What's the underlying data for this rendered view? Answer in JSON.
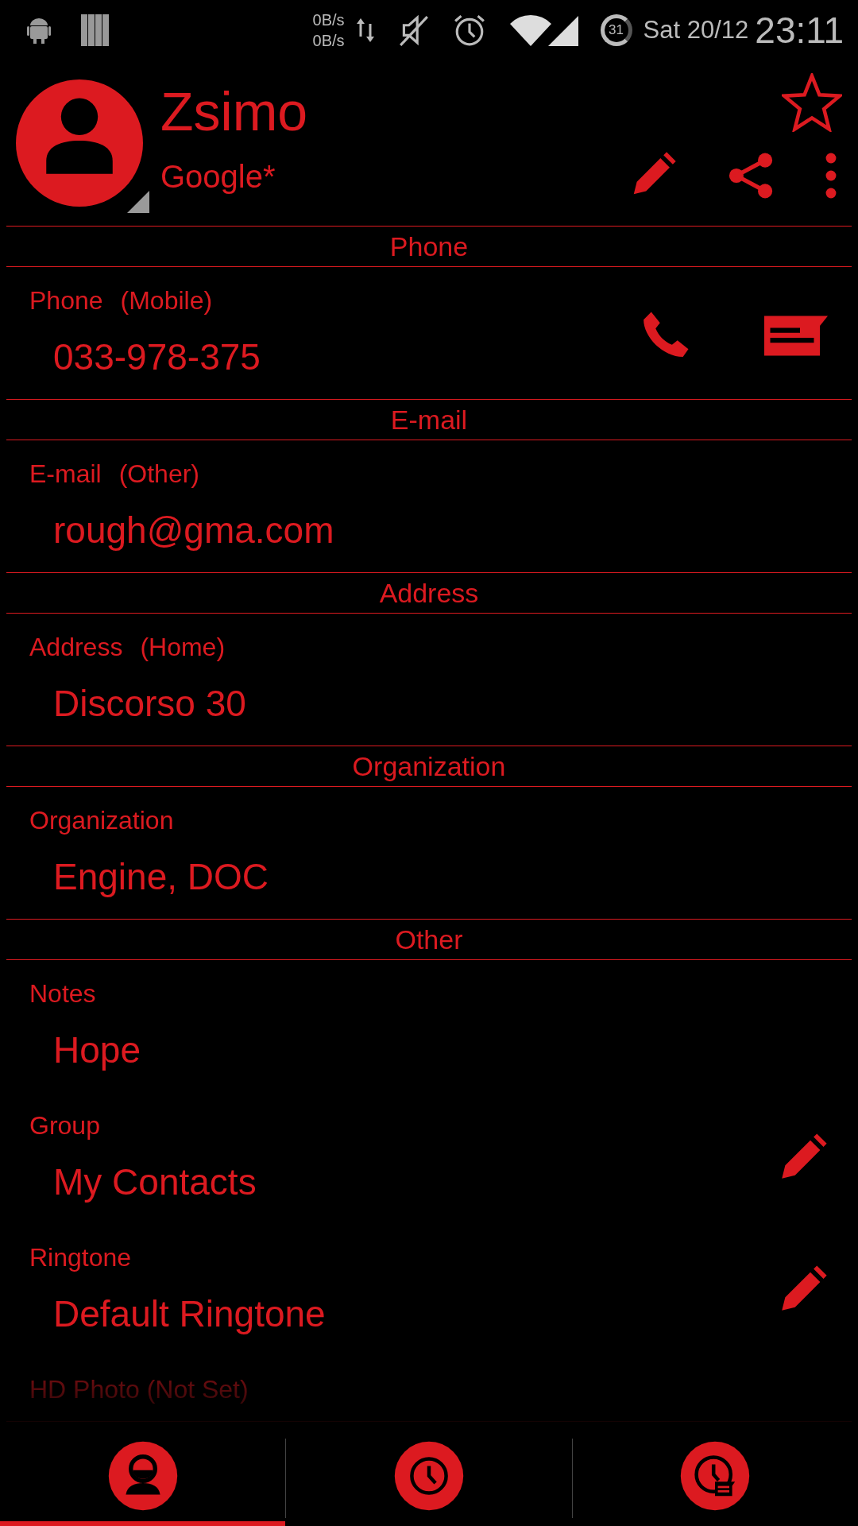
{
  "status_bar": {
    "net_up": "0B/s",
    "net_down": "0B/s",
    "battery": "31",
    "date": "Sat 20/12",
    "time": "23:11"
  },
  "contact": {
    "name": "Zsimo",
    "account": "Google*",
    "starred": false
  },
  "sections": [
    {
      "title": "Phone",
      "rows": [
        {
          "label": "Phone",
          "type": "(Mobile)",
          "value": "033-978-375",
          "actions": [
            {
              "kind": "call"
            },
            {
              "kind": "message"
            }
          ]
        }
      ]
    },
    {
      "title": "E-mail",
      "rows": [
        {
          "label": "E-mail",
          "type": "(Other)",
          "value": "rough@gma.com",
          "actions": []
        }
      ]
    },
    {
      "title": "Address",
      "rows": [
        {
          "label": "Address",
          "type": "(Home)",
          "value": "Discorso 30",
          "actions": []
        }
      ]
    },
    {
      "title": "Organization",
      "rows": [
        {
          "label": "Organization",
          "value": "Engine, DOC",
          "actions": []
        }
      ]
    },
    {
      "title": "Other",
      "rows": [
        {
          "label": "Notes",
          "value": "Hope",
          "actions": []
        },
        {
          "label": "Group",
          "value": "My Contacts",
          "actions": [
            {
              "kind": "edit"
            }
          ]
        },
        {
          "label": "Ringtone",
          "value": "Default Ringtone",
          "actions": [
            {
              "kind": "edit"
            }
          ]
        },
        {
          "label": "HD Photo (Not Set)",
          "actions": []
        }
      ]
    }
  ],
  "tabs": [
    {
      "kind": "contact",
      "selected": true
    },
    {
      "kind": "history",
      "selected": false
    },
    {
      "kind": "scheduled",
      "selected": false
    }
  ]
}
